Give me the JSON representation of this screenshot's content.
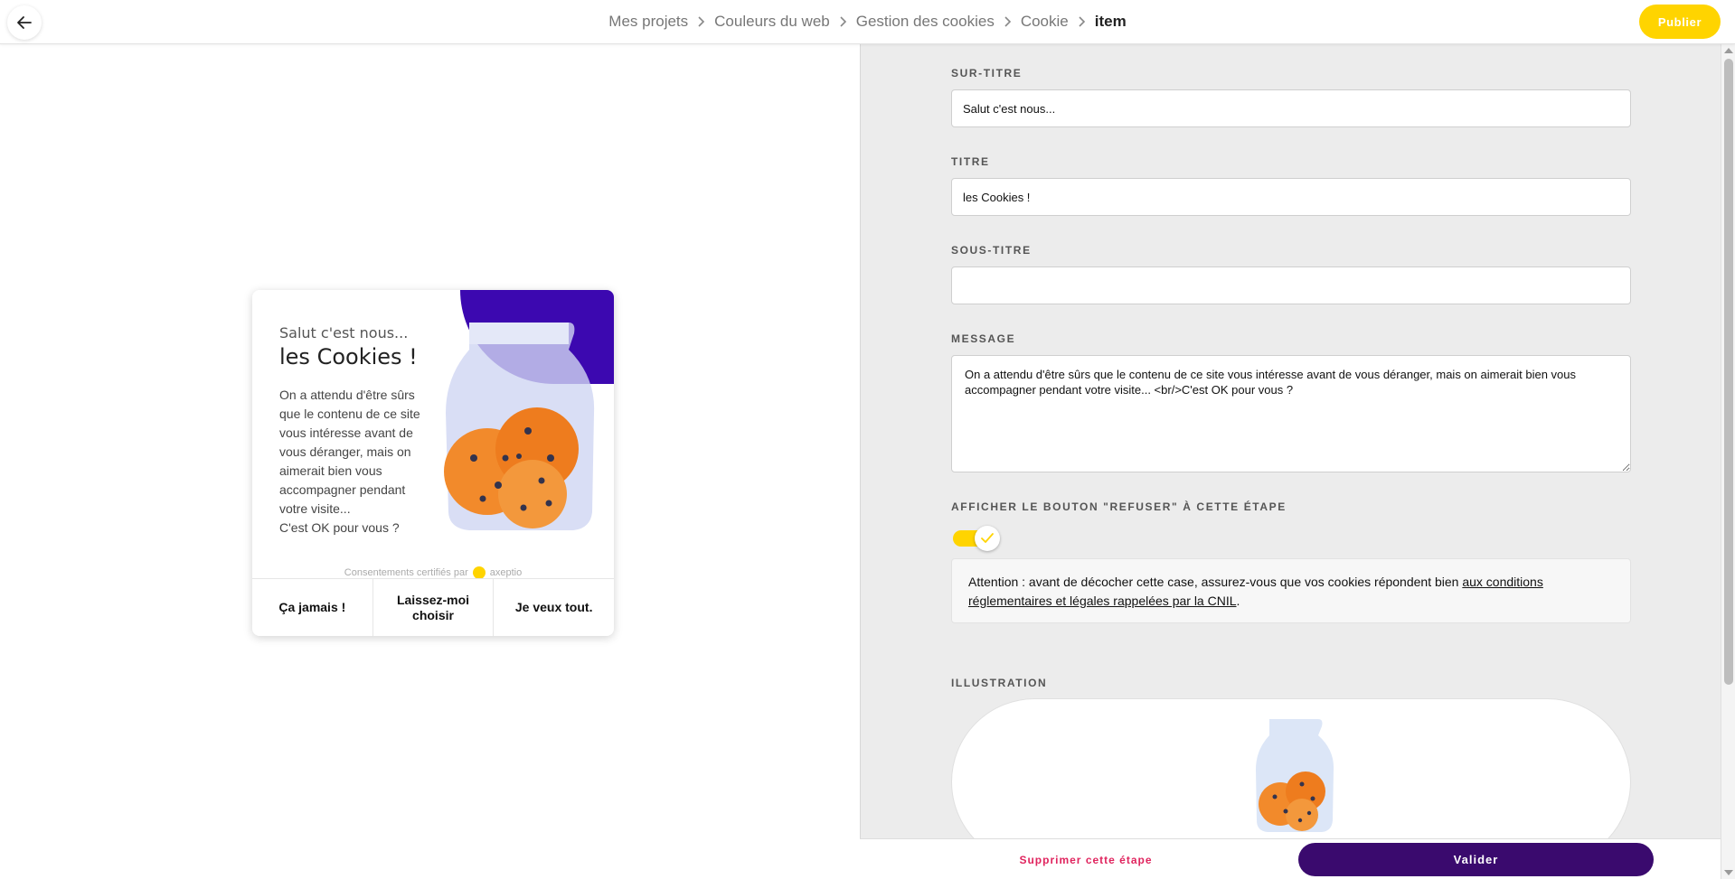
{
  "header": {
    "breadcrumb": [
      "Mes projets",
      "Couleurs du web",
      "Gestion des cookies",
      "Cookie",
      "item"
    ],
    "publish_label": "Publier",
    "colors": {
      "accent": "#ffd400"
    }
  },
  "preview": {
    "pretitle": "Salut c'est nous...",
    "title": "les Cookies !",
    "message": "On a attendu d'être sûrs que le contenu de ce site vous intéresse avant de vous déranger, mais on aimerait bien vous accompagner pendant votre visite...",
    "message_end": "C'est OK pour vous ?",
    "certification": "Consentements certifiés par",
    "brand": "axeptio",
    "actions": [
      "Ça jamais !",
      "Laissez-moi choisir",
      "Je veux tout."
    ],
    "colors": {
      "blob": "#3c08b0"
    }
  },
  "form": {
    "surtitre": {
      "label": "SUR-TITRE",
      "value": "Salut c'est nous..."
    },
    "titre": {
      "label": "TITRE",
      "value": "les Cookies !"
    },
    "soustitre": {
      "label": "SOUS-TITRE",
      "value": ""
    },
    "message": {
      "label": "MESSAGE",
      "value": "On a attendu d'être sûrs que le contenu de ce site vous intéresse avant de vous déranger, mais on aimerait bien vous accompagner pendant votre visite... <br/>C'est OK pour vous ?"
    },
    "refuse_toggle": {
      "label": "AFFICHER LE BOUTON \"REFUSER\" À CETTE ÉTAPE",
      "checked": true
    },
    "warning": {
      "text": "Attention : avant de décocher cette case, assurez-vous que vos cookies répondent bien ",
      "link": "aux conditions réglementaires et légales rappelées par la CNIL",
      "end": "."
    },
    "illustration_label": "ILLUSTRATION"
  },
  "footer": {
    "delete_label": "Supprimer cette étape",
    "validate_label": "Valider",
    "colors": {
      "delete": "#e0245e",
      "validate": "#3a0a6e"
    }
  }
}
